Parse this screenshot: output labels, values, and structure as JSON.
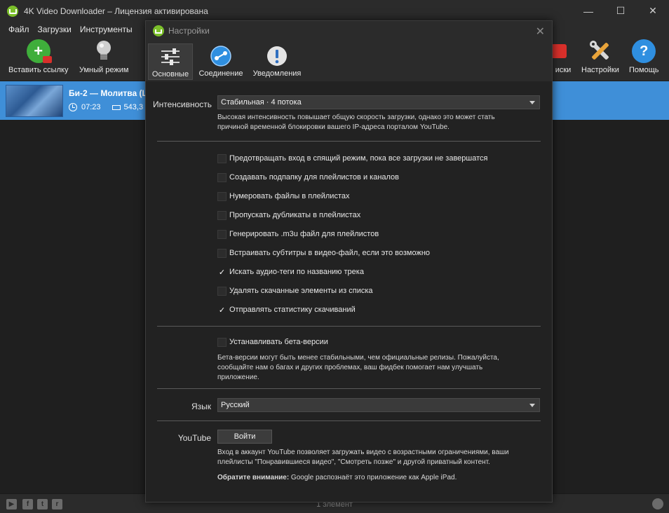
{
  "window": {
    "title": "4K Video Downloader – Лицензия активирована",
    "minimize": "—",
    "maximize": "☐",
    "close": "✕"
  },
  "menu": [
    "Файл",
    "Загрузки",
    "Инструменты"
  ],
  "toolbar": {
    "paste_link": "Вставить ссылку",
    "smart_mode": "Умный режим",
    "subscriptions_partial": "иски",
    "settings": "Настройки",
    "help": "Помощь",
    "help_glyph": "?"
  },
  "download": {
    "title": "Би-2 — Молитва (L",
    "duration": "07:23",
    "size": "543,3 N"
  },
  "status": {
    "count": "1 элемент",
    "social": [
      "YouTube",
      "Facebook",
      "Twitter",
      "Reddit"
    ]
  },
  "dialog": {
    "title": "Настройки",
    "close": "✕",
    "tabs": [
      {
        "label": "Основные",
        "icon": "sliders-icon",
        "active": true
      },
      {
        "label": "Соединение",
        "icon": "network-icon",
        "active": false
      },
      {
        "label": "Уведомления",
        "icon": "alert-icon",
        "active": false
      }
    ],
    "intensity": {
      "label": "Интенсивность",
      "value": "Стабильная · 4 потока",
      "hint_line1": "Высокая интенсивность повышает общую скорость загрузки, однако это может стать",
      "hint_line2": "причиной временной блокировки вашего IP-адреса порталом YouTube."
    },
    "options": [
      {
        "label": "Предотвращать вход в спящий режим, пока все загрузки не завершатся",
        "checked": false
      },
      {
        "label": "Создавать подпапку для плейлистов и каналов",
        "checked": false
      },
      {
        "label": "Нумеровать файлы в плейлистах",
        "checked": false
      },
      {
        "label": "Пропускать дубликаты в плейлистах",
        "checked": false
      },
      {
        "label": "Генерировать .m3u файл для плейлистов",
        "checked": false
      },
      {
        "label": "Встраивать субтитры в видео-файл, если это возможно",
        "checked": false
      },
      {
        "label": "Искать аудио-теги по названию трека",
        "checked": true
      },
      {
        "label": "Удалять скачанные элементы из списка",
        "checked": false
      },
      {
        "label": "Отправлять статистику скачиваний",
        "checked": true
      }
    ],
    "beta": {
      "label": "Устанавливать бета-версии",
      "checked": false,
      "hint_line1": "Бета-версии могут быть менее стабильными, чем официальные релизы.  Пожалуйста,",
      "hint_line2": "сообщайте нам о багах и других проблемах, ваш фидбек помогает нам улучшать",
      "hint_line3": "приложение."
    },
    "language": {
      "label": "Язык",
      "value": "Русский"
    },
    "youtube": {
      "label": "YouTube",
      "button": "Войти",
      "hint_line1": "Вход в аккаунт YouTube позволяет загружать видео с возрастными ограничениями, ваши",
      "hint_line2": "плейлисты \"Понравившиеся видео\", \"Смотреть позже\" и другой приватный контент.",
      "note_bold": "Обратите внимание:",
      "note_text": " Google распознаёт это приложение как Apple iPad."
    }
  }
}
